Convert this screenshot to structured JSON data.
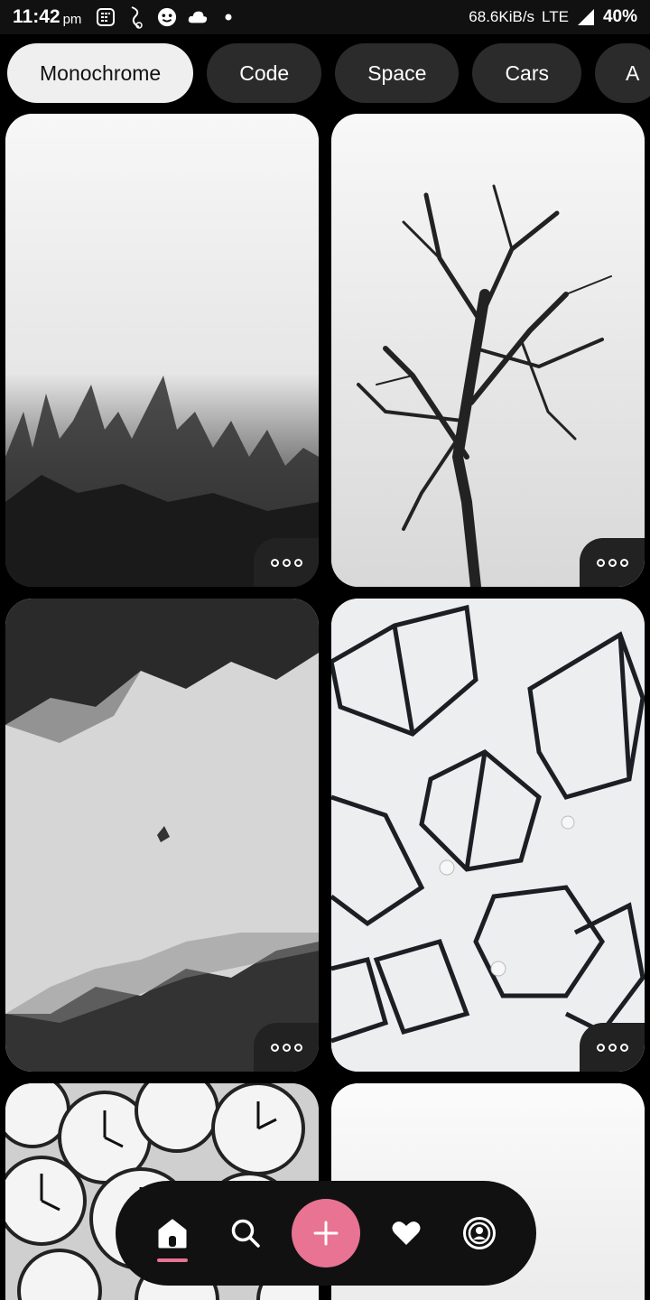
{
  "status_bar": {
    "time": "11:42",
    "ampm": "pm",
    "net_speed": "68.6KiB/s",
    "network": "LTE",
    "battery": "40%"
  },
  "categories": [
    "Monochrome",
    "Code",
    "Space",
    "Cars",
    "A"
  ],
  "active_category": "Monochrome",
  "wallpapers": [
    {
      "name": "foggy-forest"
    },
    {
      "name": "bare-tree"
    },
    {
      "name": "upside-down-fog-forest"
    },
    {
      "name": "wire-cubes"
    },
    {
      "name": "clocks"
    },
    {
      "name": "white-mist"
    }
  ],
  "nav": {
    "items": [
      "home-icon",
      "search-icon",
      "add-icon",
      "heart-icon",
      "profile-icon"
    ],
    "accent": "#e87393"
  }
}
